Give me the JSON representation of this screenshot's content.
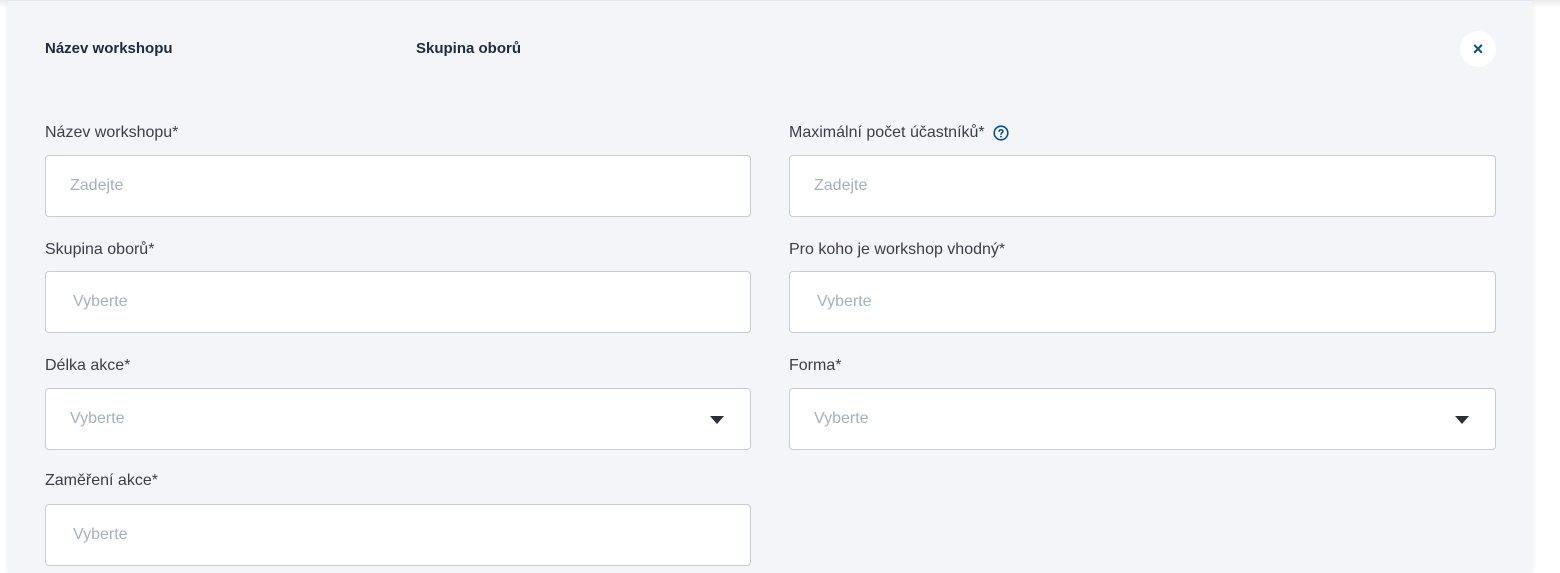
{
  "header": {
    "col1": "Název workshopu",
    "col2": "Skupina oborů",
    "close_symbol": "×"
  },
  "form": {
    "workshop_name": {
      "label": "Název workshopu*",
      "placeholder": "Zadejte"
    },
    "max_participants": {
      "label": "Maximální počet účastníků*",
      "placeholder": "Zadejte",
      "help_icon": "question-circle-icon"
    },
    "field_group": {
      "label": "Skupina oborů*",
      "placeholder": "Vyberte"
    },
    "suitable_for": {
      "label": "Pro koho je workshop vhodný*",
      "placeholder": "Vyberte"
    },
    "duration": {
      "label": "Délka akce*",
      "placeholder": "Vyberte"
    },
    "form_type": {
      "label": "Forma*",
      "placeholder": "Vyberte"
    },
    "focus": {
      "label": "Zaměření akce*",
      "placeholder": "Vyberte"
    }
  },
  "colors": {
    "panel_bg": "#f3f5f9",
    "accent": "#0b4f8a",
    "placeholder": "#a5b0bf"
  }
}
